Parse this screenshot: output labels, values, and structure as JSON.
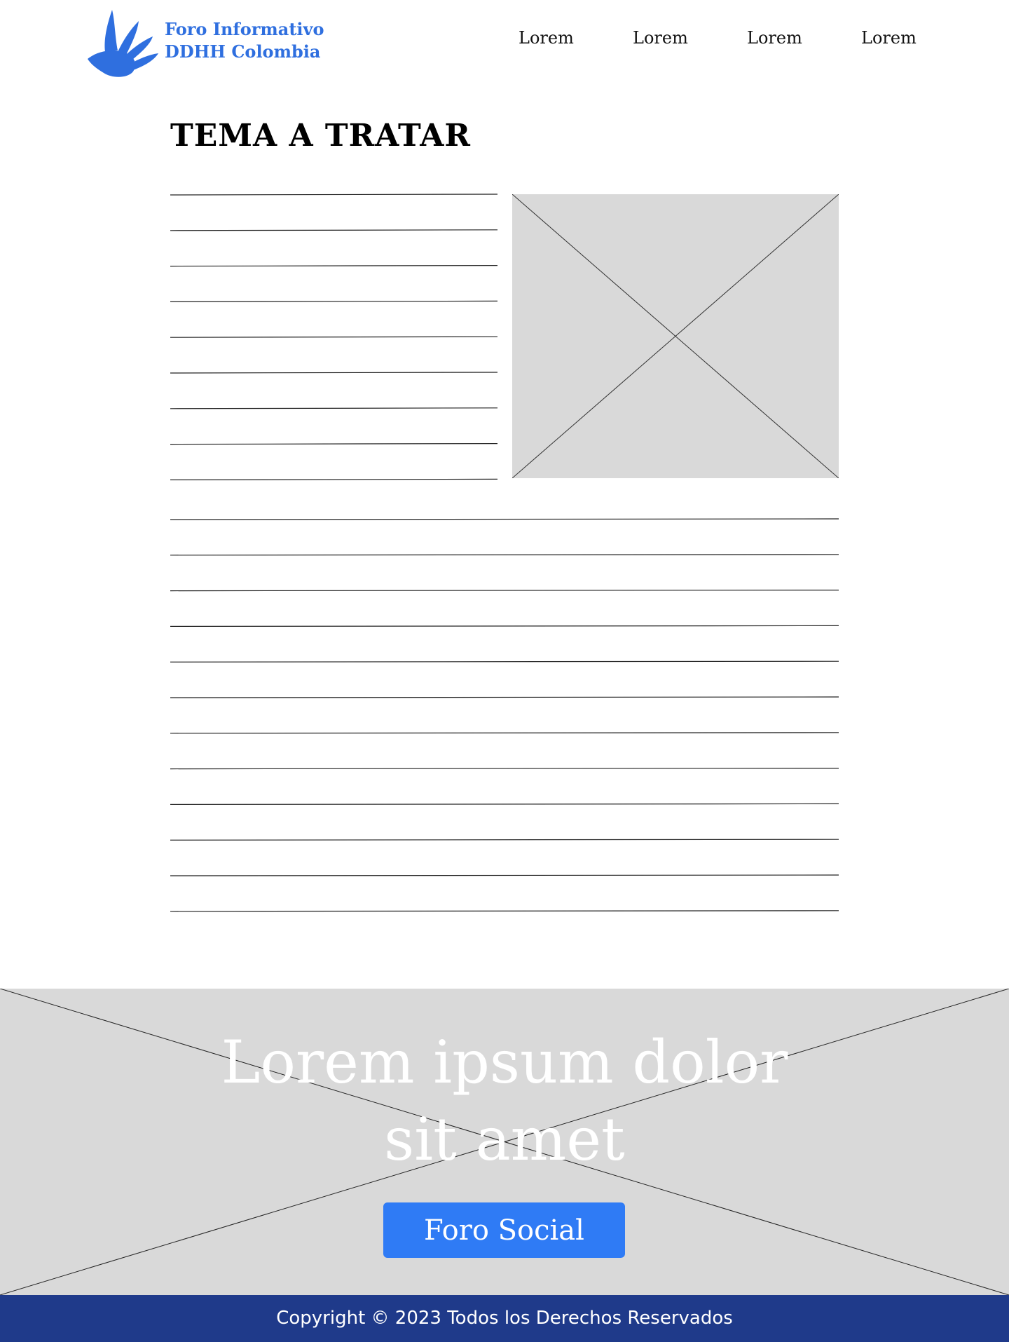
{
  "header": {
    "brand_line1": "Foro Informativo",
    "brand_line2": "DDHH Colombia",
    "logo_icon": "hand-icon",
    "nav": [
      "Lorem",
      "Lorem",
      "Lorem",
      "Lorem"
    ]
  },
  "article": {
    "title": "TEMA A TRATAR",
    "image_placeholder_icon": "image-placeholder-icon"
  },
  "hero": {
    "title_line1": "Lorem ipsum dolor",
    "title_line2": "sit amet",
    "button_label": "Foro Social"
  },
  "footer": {
    "copyright": "Copyright © 2023 Todos los Derechos Reservados"
  },
  "colors": {
    "brand": "#2f6fdf",
    "button": "#2f7bf5",
    "footer": "#1f3a8a",
    "placeholder": "#d9d9d9"
  }
}
